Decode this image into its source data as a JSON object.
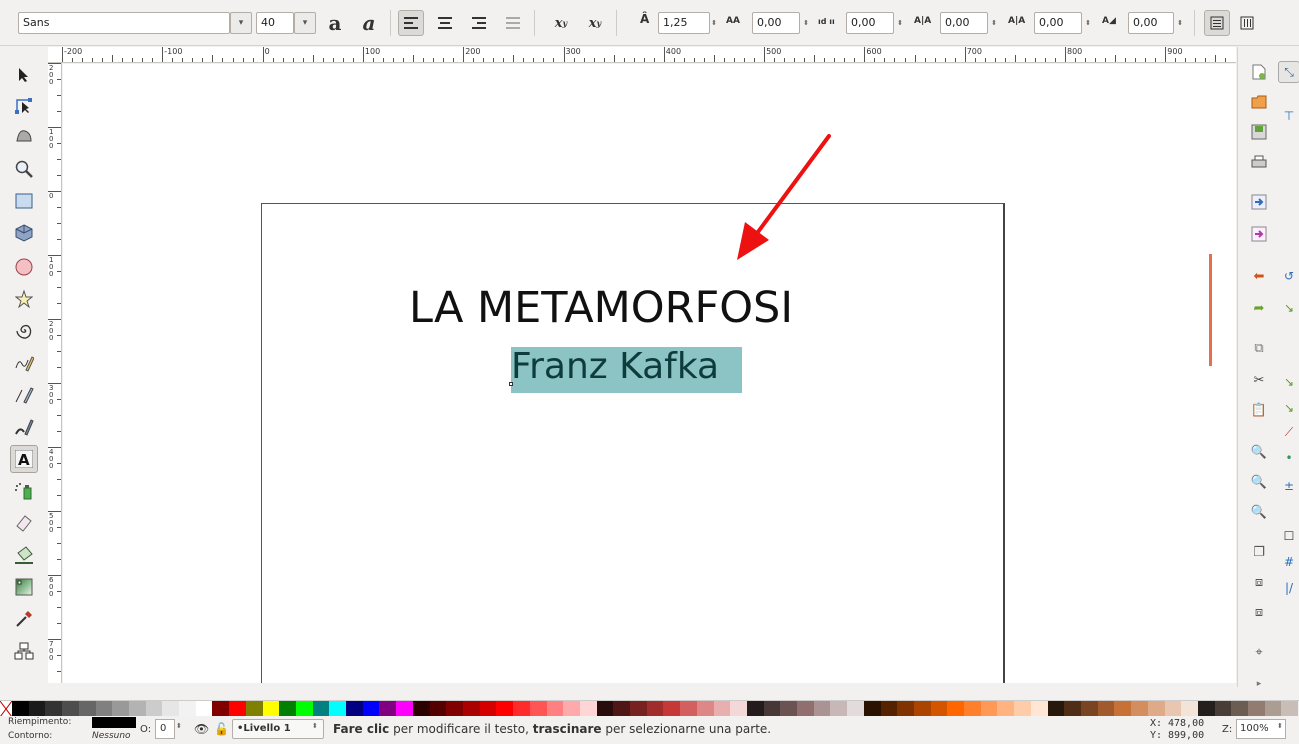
{
  "toolbar": {
    "font_family": "Sans",
    "font_size": "40",
    "line_spacing": "1,25",
    "letter_spacing": "0,00",
    "word_spacing": "0,00",
    "horizontal_kerning": "0,00",
    "vertical_shift": "0,00",
    "rotation": "0,00",
    "icons": [
      "bold-icon",
      "italic-icon",
      "align-left-icon",
      "align-center-icon",
      "align-right-icon",
      "justify-icon",
      "superscript-icon",
      "subscript-icon",
      "line-spacing-icon",
      "letter-spacing-icon",
      "word-spacing-icon",
      "kerning-icon",
      "vertical-shift-icon",
      "rotation-icon",
      "horizontal-text-icon",
      "vertical-text-icon"
    ]
  },
  "ruler": {
    "h_labels": [
      "-200",
      "-100",
      "0",
      "100",
      "200",
      "300",
      "400",
      "500",
      "600",
      "700",
      "800",
      "900"
    ],
    "v_labels": [
      "2 0 0",
      "1 0 0",
      "0",
      "1 0 0",
      "2 0 0",
      "3 0 0",
      "4 0 0",
      "5 0 0",
      "6 0 0",
      "7 0 0",
      "8 0 0"
    ]
  },
  "tools": [
    "selector-tool",
    "node-tool",
    "tweak-tool",
    "zoom-tool",
    "rectangle-tool",
    "3d-box-tool",
    "ellipse-tool",
    "star-tool",
    "spiral-tool",
    "pencil-tool",
    "pen-tool",
    "calligraphy-tool",
    "text-tool",
    "spray-tool",
    "eraser-tool",
    "paint-bucket-tool",
    "gradient-tool",
    "dropper-tool",
    "connector-tool"
  ],
  "document": {
    "title": "LA METAMORFOSI",
    "author": "Franz Kafka"
  },
  "commands": [
    "new-document-icon",
    "open-icon",
    "save-icon",
    "print-icon",
    "import-icon",
    "export-icon",
    "undo-icon",
    "redo-icon",
    "copy-icon",
    "cut-icon",
    "paste-icon",
    "zoom-selection-icon",
    "zoom-drawing-icon",
    "zoom-page-icon",
    "duplicate-icon",
    "clone-icon",
    "unlink-clone-icon",
    "select-same-icon"
  ],
  "palette": [
    "#000000",
    "#1a1a1a",
    "#333333",
    "#4d4d4d",
    "#666666",
    "#808080",
    "#999999",
    "#b3b3b3",
    "#cccccc",
    "#e6e6e6",
    "#f2f2f2",
    "#ffffff",
    "#800000",
    "#ff0000",
    "#808000",
    "#ffff00",
    "#008000",
    "#00ff00",
    "#008080",
    "#00ffff",
    "#000080",
    "#0000ff",
    "#800080",
    "#ff00ff",
    "#2b0000",
    "#550000",
    "#800000",
    "#aa0000",
    "#d40000",
    "#ff0000",
    "#ff2a2a",
    "#ff5555",
    "#ff8080",
    "#ffaaaa",
    "#ffd5d5",
    "#280b0b",
    "#501616",
    "#782121",
    "#a02c2c",
    "#c83737",
    "#d35f5f",
    "#de8787",
    "#e9afaf",
    "#f4d7d7",
    "#241c1c",
    "#483737",
    "#6c5353",
    "#916f6f",
    "#ac9393",
    "#c8b7b7",
    "#e3dbdb",
    "#2b1100",
    "#552200",
    "#803300",
    "#aa4400",
    "#d45500",
    "#ff6600",
    "#ff7f2a",
    "#ff9955",
    "#ffb380",
    "#ffccaa",
    "#ffe6d5",
    "#28170b",
    "#502d16",
    "#784421",
    "#a05a2c",
    "#c87137",
    "#d38d5f",
    "#deaa87",
    "#e9c6af",
    "#f4e3d7",
    "#241f1c",
    "#483e37",
    "#6c5d53",
    "#917c6f",
    "#ac9d93",
    "#c8beb7"
  ],
  "status": {
    "fill_label": "Riempimento:",
    "stroke_label": "Contorno:",
    "stroke_value": "Nessuno",
    "opacity_label": "O:",
    "opacity_value": "0",
    "layer": "•Livello 1",
    "message_bold1": "Fare clic",
    "message_part1": " per modificare il testo, ",
    "message_bold2": "trascinare",
    "message_part2": " per selezionarne una parte.",
    "x_label": "X:",
    "x_value": "478,00",
    "y_label": "Y:",
    "y_value": "899,00",
    "zoom_label": "Z:",
    "zoom_value": "100%"
  }
}
